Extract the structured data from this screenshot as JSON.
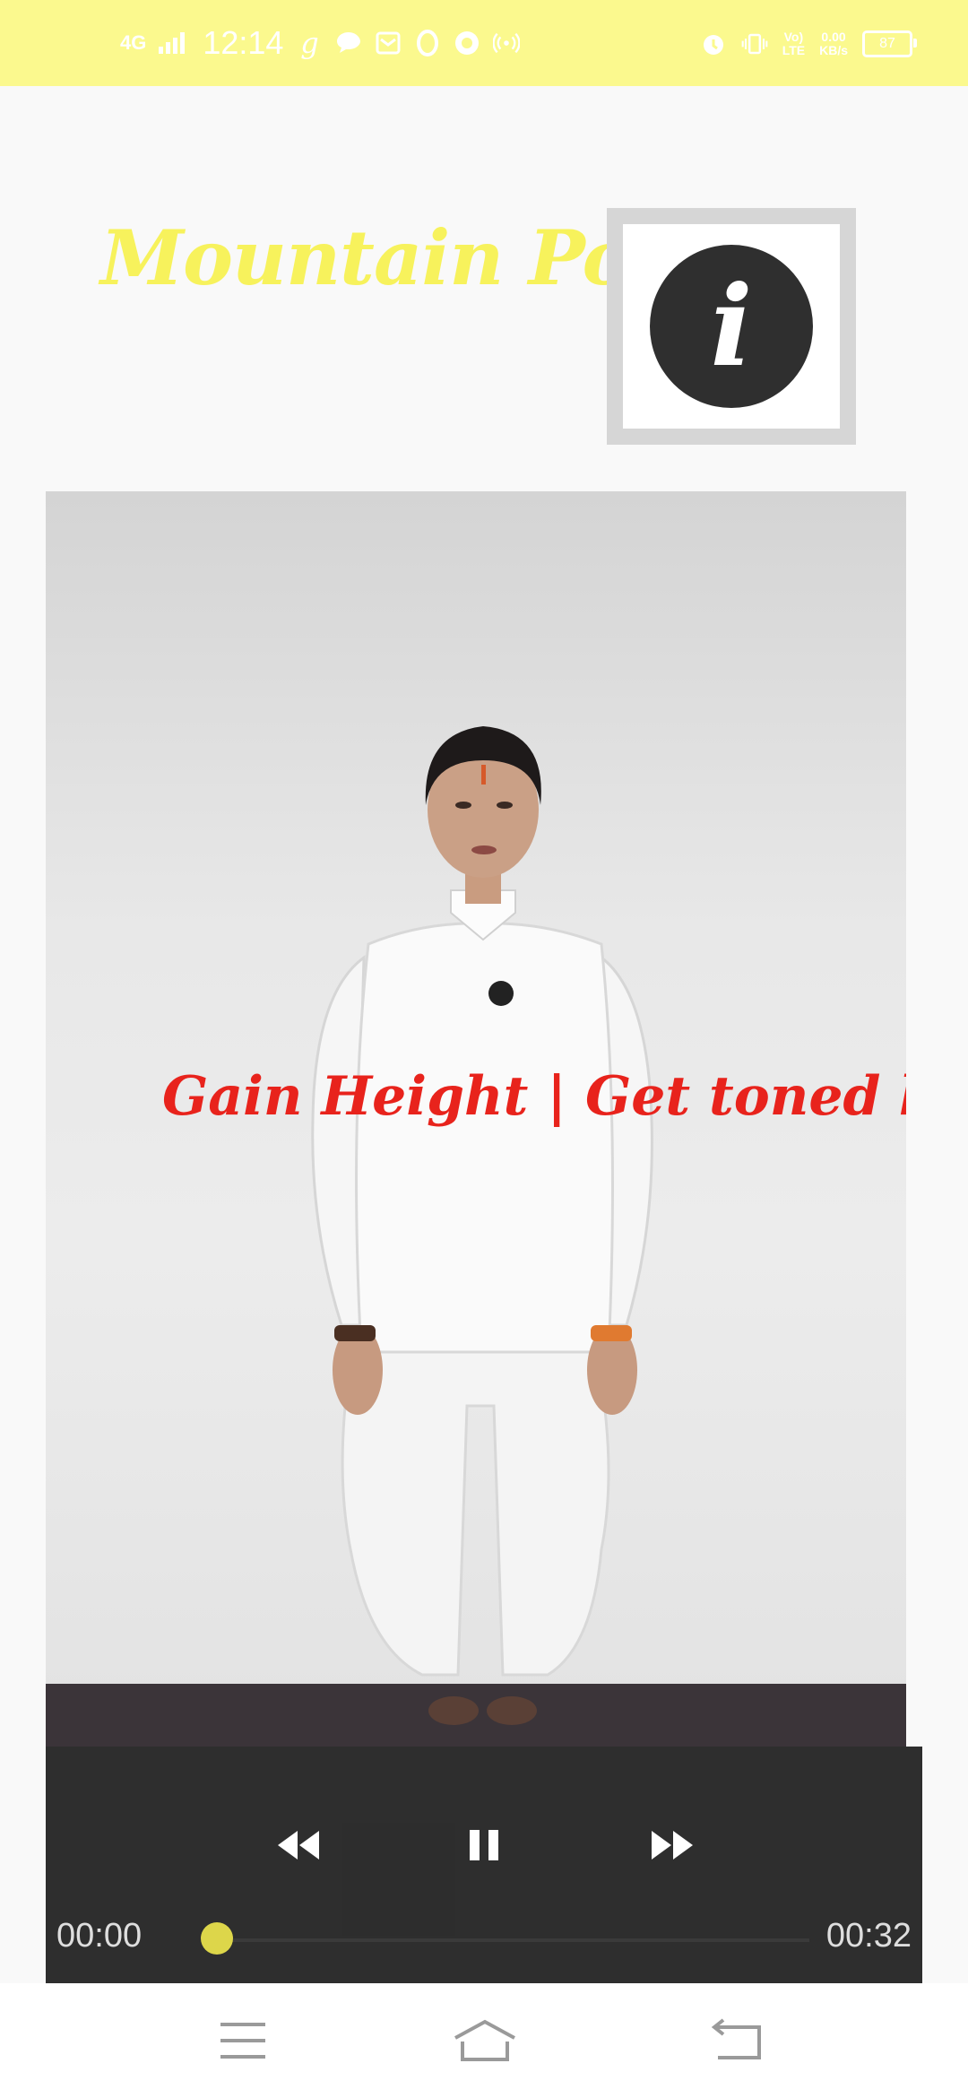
{
  "status_bar": {
    "network": "4G",
    "time": "12:14",
    "icons_left": [
      "g-icon",
      "chat-bubble-icon",
      "mail-icon",
      "opera-icon",
      "circle-icon",
      "hotspot-icon"
    ],
    "icons_right": [
      "alarm-icon",
      "vibrate-icon"
    ],
    "volte_line1": "Vo)",
    "volte_line2": "LTE",
    "speed_value": "0.00",
    "speed_unit": "KB/s",
    "battery": "87"
  },
  "header": {
    "title": "Mountain Pose",
    "info_button_icon": "info-icon"
  },
  "video": {
    "caption": "Gain Height | Get toned body"
  },
  "player": {
    "current_time": "00:00",
    "duration": "00:32",
    "progress_fraction": 0.0,
    "state": "playing",
    "accent_color": "#ddd64a"
  },
  "nav_bar": {
    "buttons": [
      "menu-icon",
      "home-icon",
      "back-icon"
    ]
  },
  "colors": {
    "status_bar_bg": "#fbf98e",
    "title_color": "#f7f25c",
    "caption_color": "#e8231c"
  }
}
